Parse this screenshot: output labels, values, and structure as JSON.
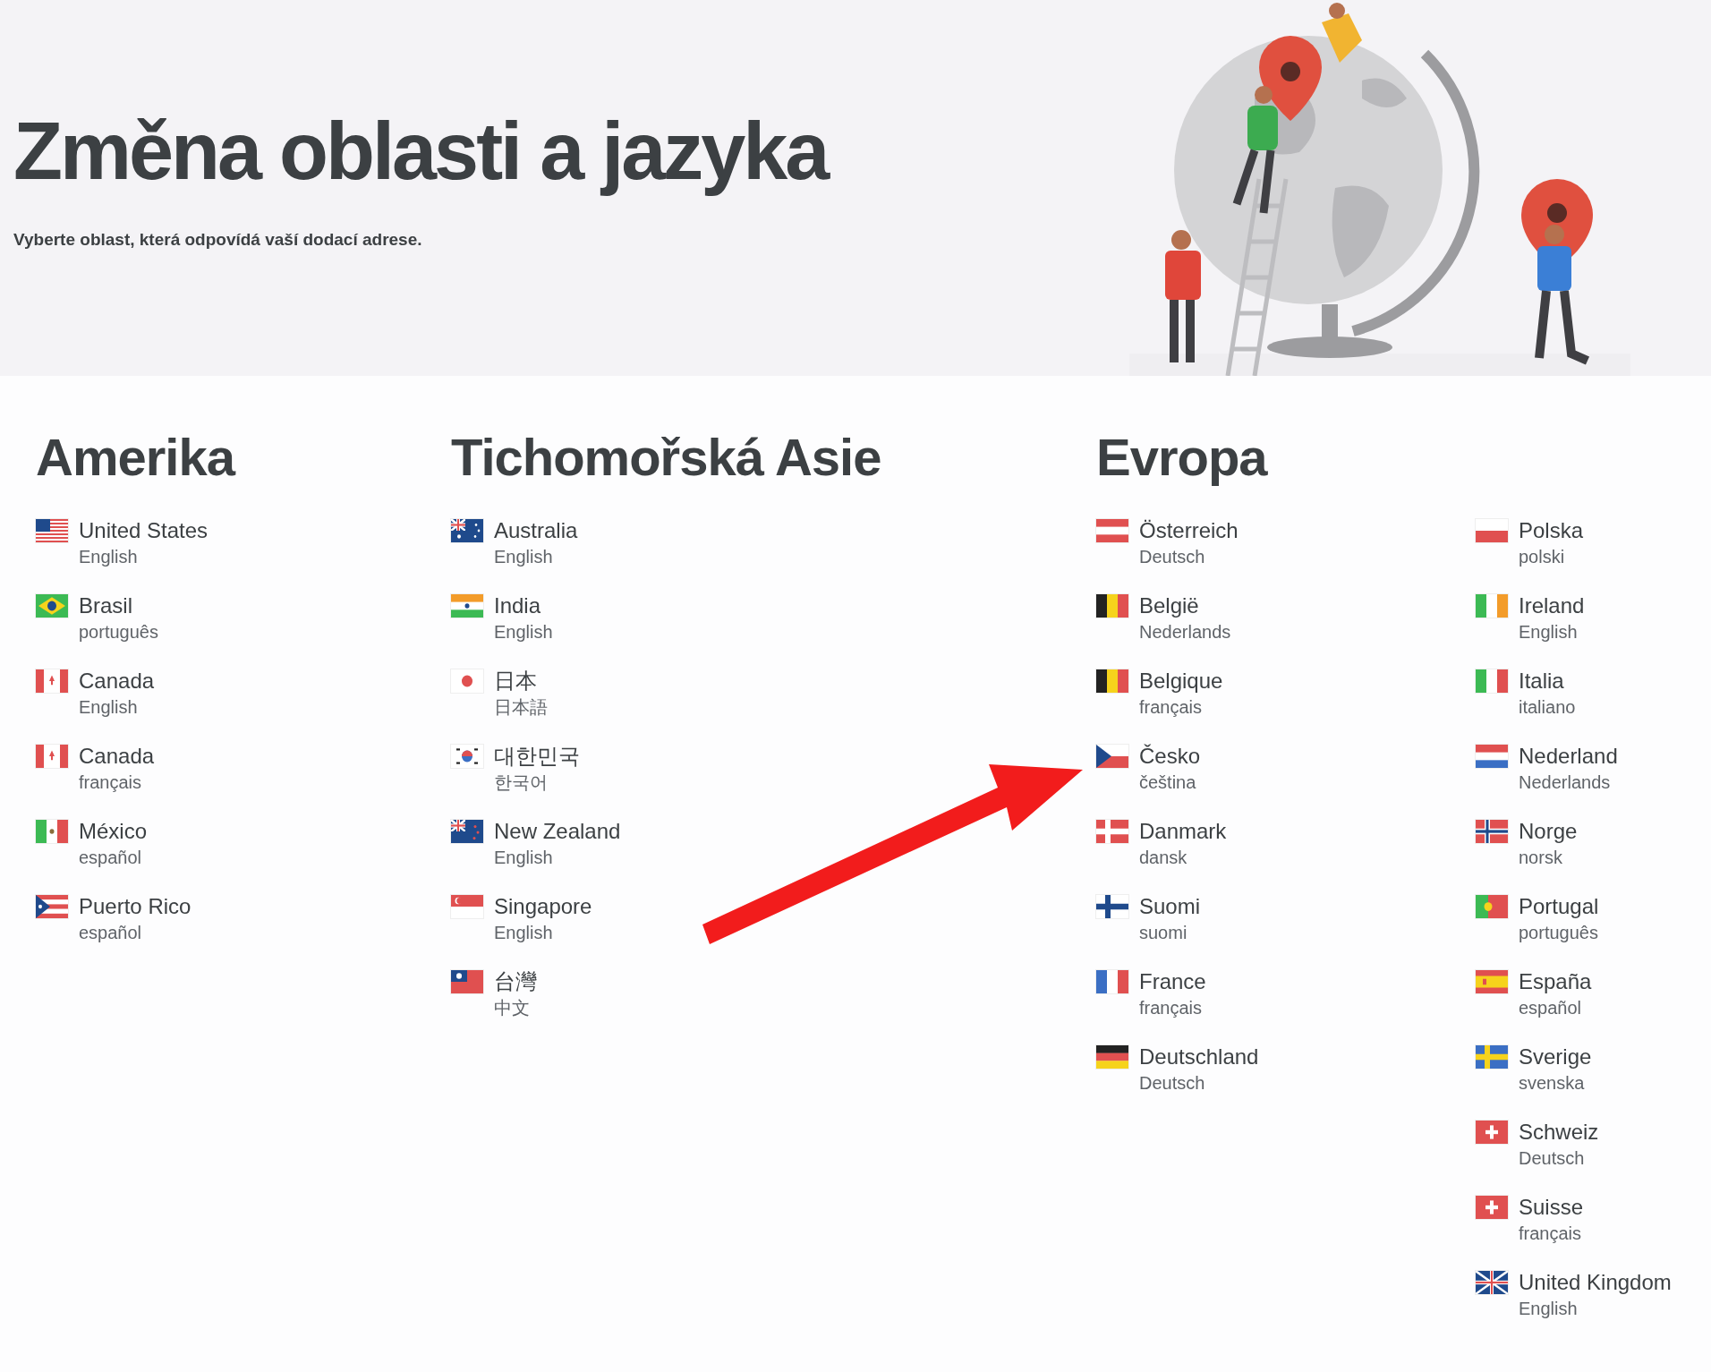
{
  "header": {
    "title": "Změna oblasti a jazyka",
    "subtitle": "Vyberte oblast, která odpovídá vaší dodací adrese."
  },
  "regions": [
    {
      "heading": "Amerika",
      "columns": [
        [
          {
            "kind": "us",
            "country": "United States",
            "language": "English"
          },
          {
            "kind": "br",
            "country": "Brasil",
            "language": "português"
          },
          {
            "kind": "ca",
            "country": "Canada",
            "language": "English"
          },
          {
            "kind": "ca",
            "country": "Canada",
            "language": "français"
          },
          {
            "kind": "mx",
            "country": "México",
            "language": "español"
          },
          {
            "kind": "pr",
            "country": "Puerto Rico",
            "language": "español"
          }
        ]
      ]
    },
    {
      "heading": "Tichomořská Asie",
      "columns": [
        [
          {
            "kind": "au",
            "country": "Australia",
            "language": "English"
          },
          {
            "kind": "in",
            "country": "India",
            "language": "English"
          },
          {
            "kind": "jp",
            "country": "日本",
            "language": "日本語"
          },
          {
            "kind": "kr",
            "country": "대한민국",
            "language": "한국어"
          },
          {
            "kind": "nz",
            "country": "New Zealand",
            "language": "English"
          },
          {
            "kind": "sg",
            "country": "Singapore",
            "language": "English"
          },
          {
            "kind": "tw",
            "country": "台灣",
            "language": "中文"
          }
        ]
      ]
    },
    {
      "heading": "Evropa",
      "columns": [
        [
          {
            "kind": "at",
            "country": "Österreich",
            "language": "Deutsch"
          },
          {
            "kind": "be",
            "country": "België",
            "language": "Nederlands"
          },
          {
            "kind": "be",
            "country": "Belgique",
            "language": "français"
          },
          {
            "kind": "cz",
            "country": "Česko",
            "language": "čeština"
          },
          {
            "kind": "dk",
            "country": "Danmark",
            "language": "dansk"
          },
          {
            "kind": "fi",
            "country": "Suomi",
            "language": "suomi"
          },
          {
            "kind": "fr",
            "country": "France",
            "language": "français"
          },
          {
            "kind": "de",
            "country": "Deutschland",
            "language": "Deutsch"
          }
        ],
        [
          {
            "kind": "pl",
            "country": "Polska",
            "language": "polski"
          },
          {
            "kind": "ie",
            "country": "Ireland",
            "language": "English"
          },
          {
            "kind": "it",
            "country": "Italia",
            "language": "italiano"
          },
          {
            "kind": "nl",
            "country": "Nederland",
            "language": "Nederlands"
          },
          {
            "kind": "no",
            "country": "Norge",
            "language": "norsk"
          },
          {
            "kind": "pt",
            "country": "Portugal",
            "language": "português"
          },
          {
            "kind": "es",
            "country": "España",
            "language": "español"
          },
          {
            "kind": "se",
            "country": "Sverige",
            "language": "svenska"
          },
          {
            "kind": "ch",
            "country": "Schweiz",
            "language": "Deutsch"
          },
          {
            "kind": "ch",
            "country": "Suisse",
            "language": "français"
          },
          {
            "kind": "gb",
            "country": "United Kingdom",
            "language": "English"
          }
        ]
      ]
    }
  ]
}
